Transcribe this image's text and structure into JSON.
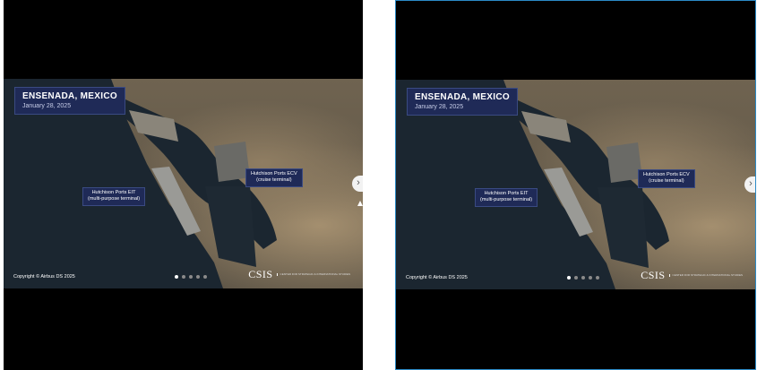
{
  "slides": [
    {
      "title": "ENSENADA, MEXICO",
      "date": "January 28, 2025",
      "label_ecv_line1": "Hutchison Ports ECV",
      "label_ecv_line2": "(cruise terminal)",
      "label_eit_line1": "Hutchison Ports EIT",
      "label_eit_line2": "(multi-purpose terminal)",
      "copyright": "Copyright © Airbus DS 2025",
      "logo": "CSIS",
      "logo_sub": "CENTER FOR STRATEGIC & INTERNATIONAL STUDIES"
    },
    {
      "title": "ENSENADA, MEXICO",
      "date": "January 28, 2025",
      "label_ecv_line1": "Hutchison Ports ECV",
      "label_ecv_line2": "(cruise terminal)",
      "label_eit_line1": "Hutchison Ports EIT",
      "label_eit_line2": "(multi-purpose terminal)",
      "copyright": "Copyright © Airbus DS 2025",
      "logo": "CSIS",
      "logo_sub": "CENTER FOR STRATEGIC & INTERNATIONAL STUDIES"
    }
  ],
  "carousel": {
    "total_slides": 5,
    "active_slide": 1
  },
  "icons": {
    "next": "chevron-right-icon"
  },
  "colors": {
    "label_bg": "#1f2a57",
    "selection_border": "#2b8ac6",
    "water": "#1a2530"
  }
}
